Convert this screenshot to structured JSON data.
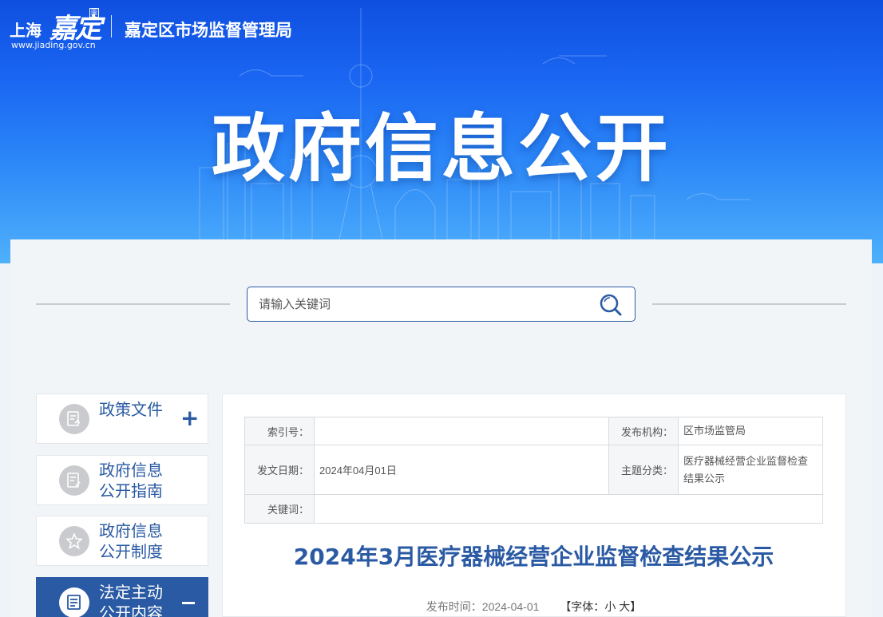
{
  "header": {
    "logo_city": "上海",
    "logo_district": "嘉定",
    "logo_seal": "圖",
    "logo_url": "www.jiading.gov.cn",
    "department": "嘉定区市场监督管理局",
    "page_title": "政府信息公开"
  },
  "search": {
    "placeholder": "请输入关键词",
    "icon": "search-icon"
  },
  "sidebar": {
    "items": [
      {
        "label_line1": "政策文件",
        "label_line2": "",
        "icon": "document-icon",
        "toggle": "+",
        "active": false
      },
      {
        "label_line1": "政府信息",
        "label_line2": "公开指南",
        "icon": "guide-icon",
        "active": false
      },
      {
        "label_line1": "政府信息",
        "label_line2": "公开制度",
        "icon": "regulation-icon",
        "active": false
      },
      {
        "label_line1": "法定主动",
        "label_line2": "公开内容",
        "icon": "list-icon",
        "toggle": "−",
        "active": true
      }
    ]
  },
  "document": {
    "meta": {
      "index_label": "索引号：",
      "index_value": "",
      "publisher_label": "发布机构：",
      "publisher_value": "区市场监管局",
      "date_label": "发文日期：",
      "date_value": "2024年04月01日",
      "topic_label": "主题分类：",
      "topic_value": "医疗器械经营企业监督检查结果公示",
      "keyword_label": "关键词：",
      "keyword_value": ""
    },
    "title": "2024年3月医疗器械经营企业监督检查结果公示",
    "publish_time": "发布时间：2024-04-01",
    "font_label_prefix": "【字体：",
    "font_small": "小",
    "font_large": "大",
    "font_label_suffix": "】"
  },
  "colors": {
    "banner_top": "#0f4fe0",
    "banner_bottom": "#4fb0fb",
    "accent": "#2a5aa3"
  }
}
